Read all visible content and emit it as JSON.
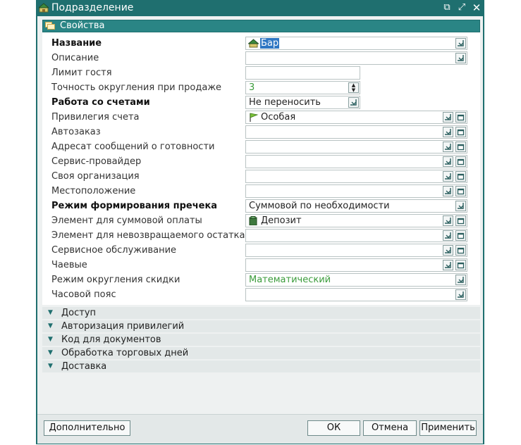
{
  "window": {
    "title": "Подразделение"
  },
  "section": {
    "label": "Свойства"
  },
  "fields": [
    {
      "label": "Название",
      "bold": true,
      "value": "Бар",
      "kind": "select-named",
      "icon": "house-icon"
    },
    {
      "label": "Описание",
      "bold": false,
      "value": "",
      "kind": "select"
    },
    {
      "label": "Лимит гостя",
      "bold": false,
      "value": "",
      "kind": "plain"
    },
    {
      "label": "Точность округления при продаже",
      "bold": false,
      "value": "3",
      "kind": "spin"
    },
    {
      "label": "Работа со счетами",
      "bold": true,
      "value": "Не переносить",
      "kind": "short-select"
    },
    {
      "label": "Привилегия счета",
      "bold": false,
      "value": "Особая",
      "kind": "ref",
      "icon": "flag-icon"
    },
    {
      "label": "Автозаказ",
      "bold": false,
      "value": "",
      "kind": "ref"
    },
    {
      "label": "Адресат сообщений о готовности",
      "bold": false,
      "value": "",
      "kind": "ref"
    },
    {
      "label": "Сервис-провайдер",
      "bold": false,
      "value": "",
      "kind": "ref"
    },
    {
      "label": "Своя организация",
      "bold": false,
      "value": "",
      "kind": "ref"
    },
    {
      "label": "Местоположение",
      "bold": false,
      "value": "",
      "kind": "ref"
    },
    {
      "label": "Режим формирования пречека",
      "bold": true,
      "value": "Суммовой по необходимости",
      "kind": "select"
    },
    {
      "label": "Элемент для суммовой оплаты",
      "bold": false,
      "value": "Депозит",
      "kind": "ref",
      "icon": "deposit-icon"
    },
    {
      "label": "Элемент для невозвращаемого остатка",
      "bold": false,
      "value": "",
      "kind": "ref"
    },
    {
      "label": "Сервисное обслуживание",
      "bold": false,
      "value": "",
      "kind": "ref"
    },
    {
      "label": "Чаевые",
      "bold": false,
      "value": "",
      "kind": "ref"
    },
    {
      "label": "Режим округления скидки",
      "bold": false,
      "value": "Математический",
      "kind": "select",
      "green": true
    },
    {
      "label": "Часовой пояс",
      "bold": false,
      "value": "",
      "kind": "select"
    }
  ],
  "groups": [
    "Доступ",
    "Авторизация привилегий",
    "Код для документов",
    "Обработка торговых дней",
    "Доставка"
  ],
  "buttons": {
    "extra": "Дополнительно",
    "ok": "ОК",
    "cancel": "Отмена",
    "apply": "Применить"
  },
  "colors": {
    "titlebar": "#1f6f6f",
    "section": "#2a8585",
    "value_green": "#3b9c3b",
    "selection": "#2f77c3"
  }
}
